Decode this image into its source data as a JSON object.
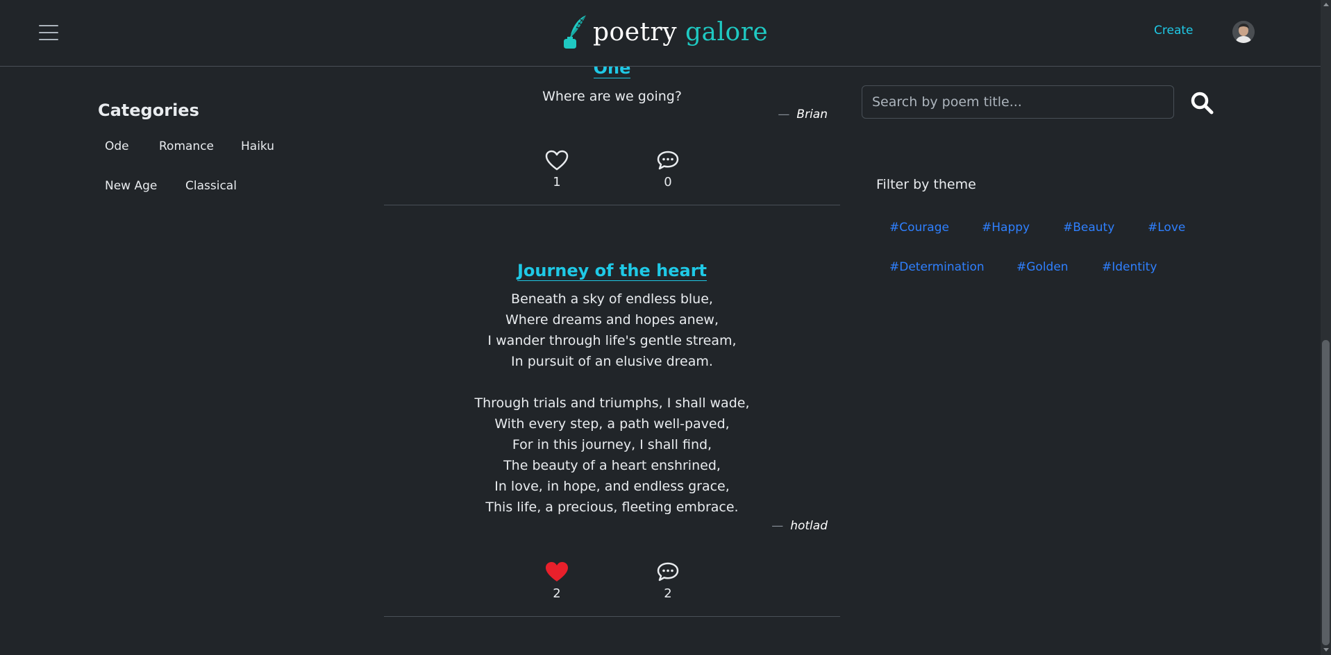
{
  "navbar": {
    "brand_part1": "poetry",
    "brand_part2": "galore",
    "create_label": "Create"
  },
  "categories": {
    "title": "Categories",
    "items": [
      "Ode",
      "Romance",
      "Haiku",
      "New Age",
      "Classical"
    ]
  },
  "poems": [
    {
      "title": "One",
      "body": "Where are we going?",
      "author": "Brian",
      "likes": "1",
      "comments": "0",
      "liked": false
    },
    {
      "title": "Journey of the heart",
      "body": "Beneath a sky of endless blue,\nWhere dreams and hopes anew,\nI wander through life's gentle stream,\nIn pursuit of an elusive dream.\n\nThrough trials and triumphs, I shall wade,\nWith every step, a path well-paved,\nFor in this journey, I shall find,\nThe beauty of a heart enshrined,\nIn love, in hope, and endless grace,\nThis life, a precious, fleeting embrace.",
      "author": "hotlad",
      "likes": "2",
      "comments": "2",
      "liked": true
    }
  ],
  "search": {
    "placeholder": "Search by poem title..."
  },
  "filter": {
    "title": "Filter by theme",
    "tags": [
      "#Courage",
      "#Happy",
      "#Beauty",
      "#Love",
      "#Determination",
      "#Golden",
      "#Identity"
    ]
  },
  "colors": {
    "accent": "#1fc9e6",
    "brand_teal": "#1fc9c2",
    "tag_blue": "#2f80ff",
    "liked_heart": "#e8202b",
    "background": "#212529"
  },
  "icons": {
    "menu": "hamburger-icon",
    "logo": "quill-inkwell-icon",
    "like": "heart-icon",
    "comment": "speech-bubble-icon",
    "search": "magnifier-icon"
  }
}
